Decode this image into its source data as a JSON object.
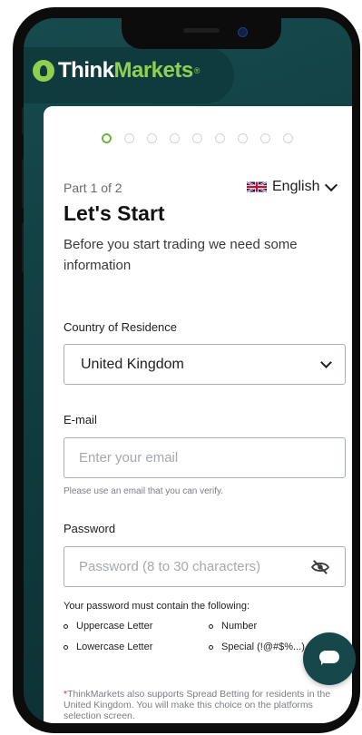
{
  "brand": {
    "think": "Think",
    "markets": "Markets",
    "reg": "®"
  },
  "progress": {
    "total_steps": 9,
    "current_step": 1
  },
  "header": {
    "part": "Part 1 of 2",
    "language": "English",
    "title": "Let's Start",
    "intro": "Before you start trading we need some information"
  },
  "country": {
    "label": "Country of Residence",
    "value": "United Kingdom"
  },
  "email": {
    "label": "E-mail",
    "placeholder": "Enter your email",
    "help": "Please use an email that you can verify."
  },
  "password": {
    "label": "Password",
    "placeholder": "Password (8 to 30 characters)",
    "requirements_title": "Your password must contain the following:",
    "requirements": [
      "Uppercase Letter",
      "Number",
      "Lowercase Letter",
      "Special (!@#$%...)"
    ]
  },
  "note": {
    "star": "*",
    "text": "ThinkMarkets also supports Spread Betting for residents in the United Kingdom. You will make this choice on the platforms selection screen."
  },
  "colors": {
    "accent": "#8fd14f",
    "brand_dark": "#0f3b3f",
    "error_star": "#d9283b"
  },
  "icons": {
    "language_flag": "uk-flag-icon",
    "password_toggle": "eye-off-icon",
    "chat": "chat-bubble-icon"
  }
}
